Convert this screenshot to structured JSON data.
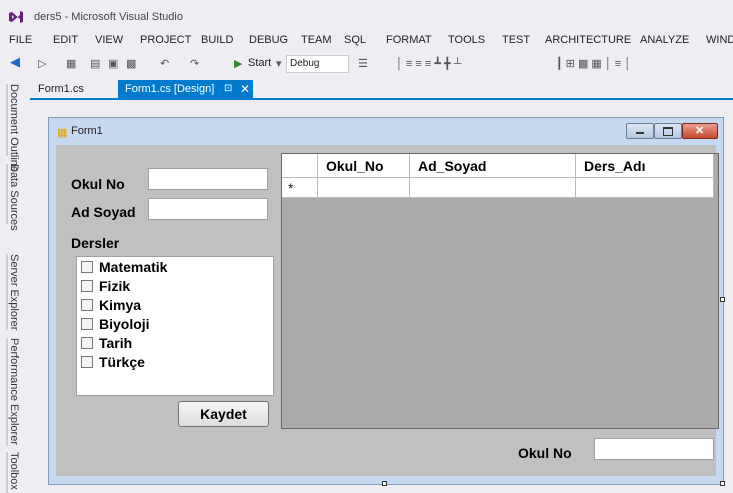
{
  "window": {
    "title": "ders5 - Microsoft Visual Studio"
  },
  "menu": [
    "FILE",
    "EDIT",
    "VIEW",
    "PROJECT",
    "BUILD",
    "DEBUG",
    "TEAM",
    "SQL",
    "FORMAT",
    "TOOLS",
    "TEST",
    "ARCHITECTURE",
    "ANALYZE",
    "WIND"
  ],
  "toolbar": {
    "start_label": "Start",
    "config": "Debug"
  },
  "left_dock": [
    "Document Outline",
    "Data Sources",
    "Server Explorer",
    "Performance Explorer",
    "Toolbox"
  ],
  "tabs": [
    {
      "label": "Form1.cs"
    },
    {
      "label": "Form1.cs [Design]"
    }
  ],
  "form": {
    "title": "Form1",
    "okulno_label": "Okul No",
    "adsoyad_label": "Ad Soyad",
    "dersler_label": "Dersler",
    "courses": [
      "Matematik",
      "Fizik",
      "Kimya",
      "Biyoloji",
      "Tarih",
      "Türkçe"
    ],
    "grid_columns": [
      "Okul_No",
      "Ad_Soyad",
      "Ders_Adı"
    ],
    "new_row_marker": "*",
    "save_button": "Kaydet",
    "search_label": "Okul No"
  },
  "colors": {
    "accent": "#007acc",
    "form_client": "#c0c0c0",
    "grid_bg": "#ababab"
  }
}
